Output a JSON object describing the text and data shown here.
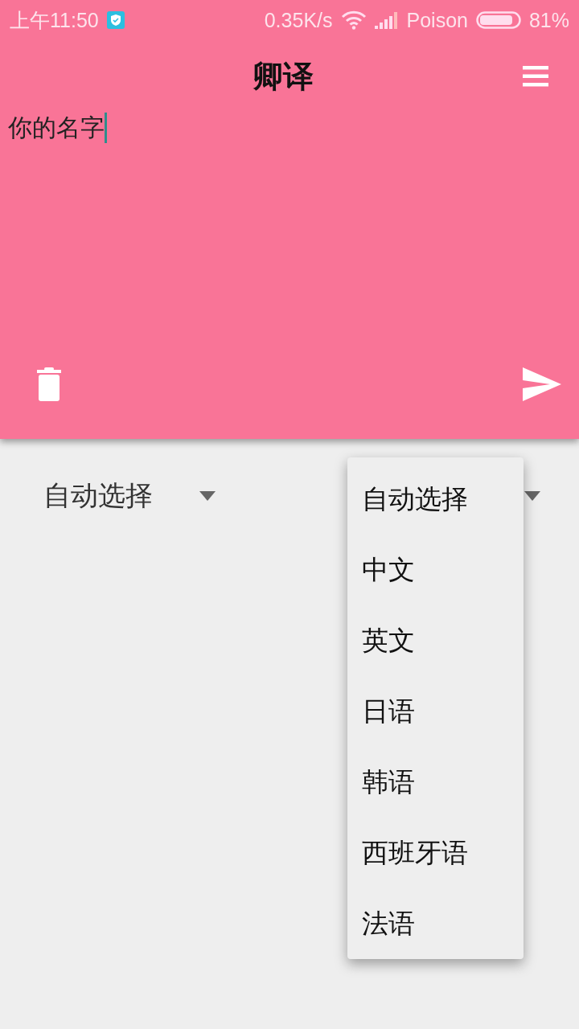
{
  "status_bar": {
    "time": "上午11:50",
    "network_speed": "0.35K/s",
    "carrier": "Poison",
    "battery": "81%"
  },
  "app_bar": {
    "title": "卿译"
  },
  "input": {
    "value": "你的名字"
  },
  "source_language": {
    "value": "自动选择"
  },
  "language_menu": {
    "items": [
      "自动选择",
      "中文",
      "英文",
      "日语",
      "韩语",
      "西班牙语",
      "法语"
    ]
  }
}
